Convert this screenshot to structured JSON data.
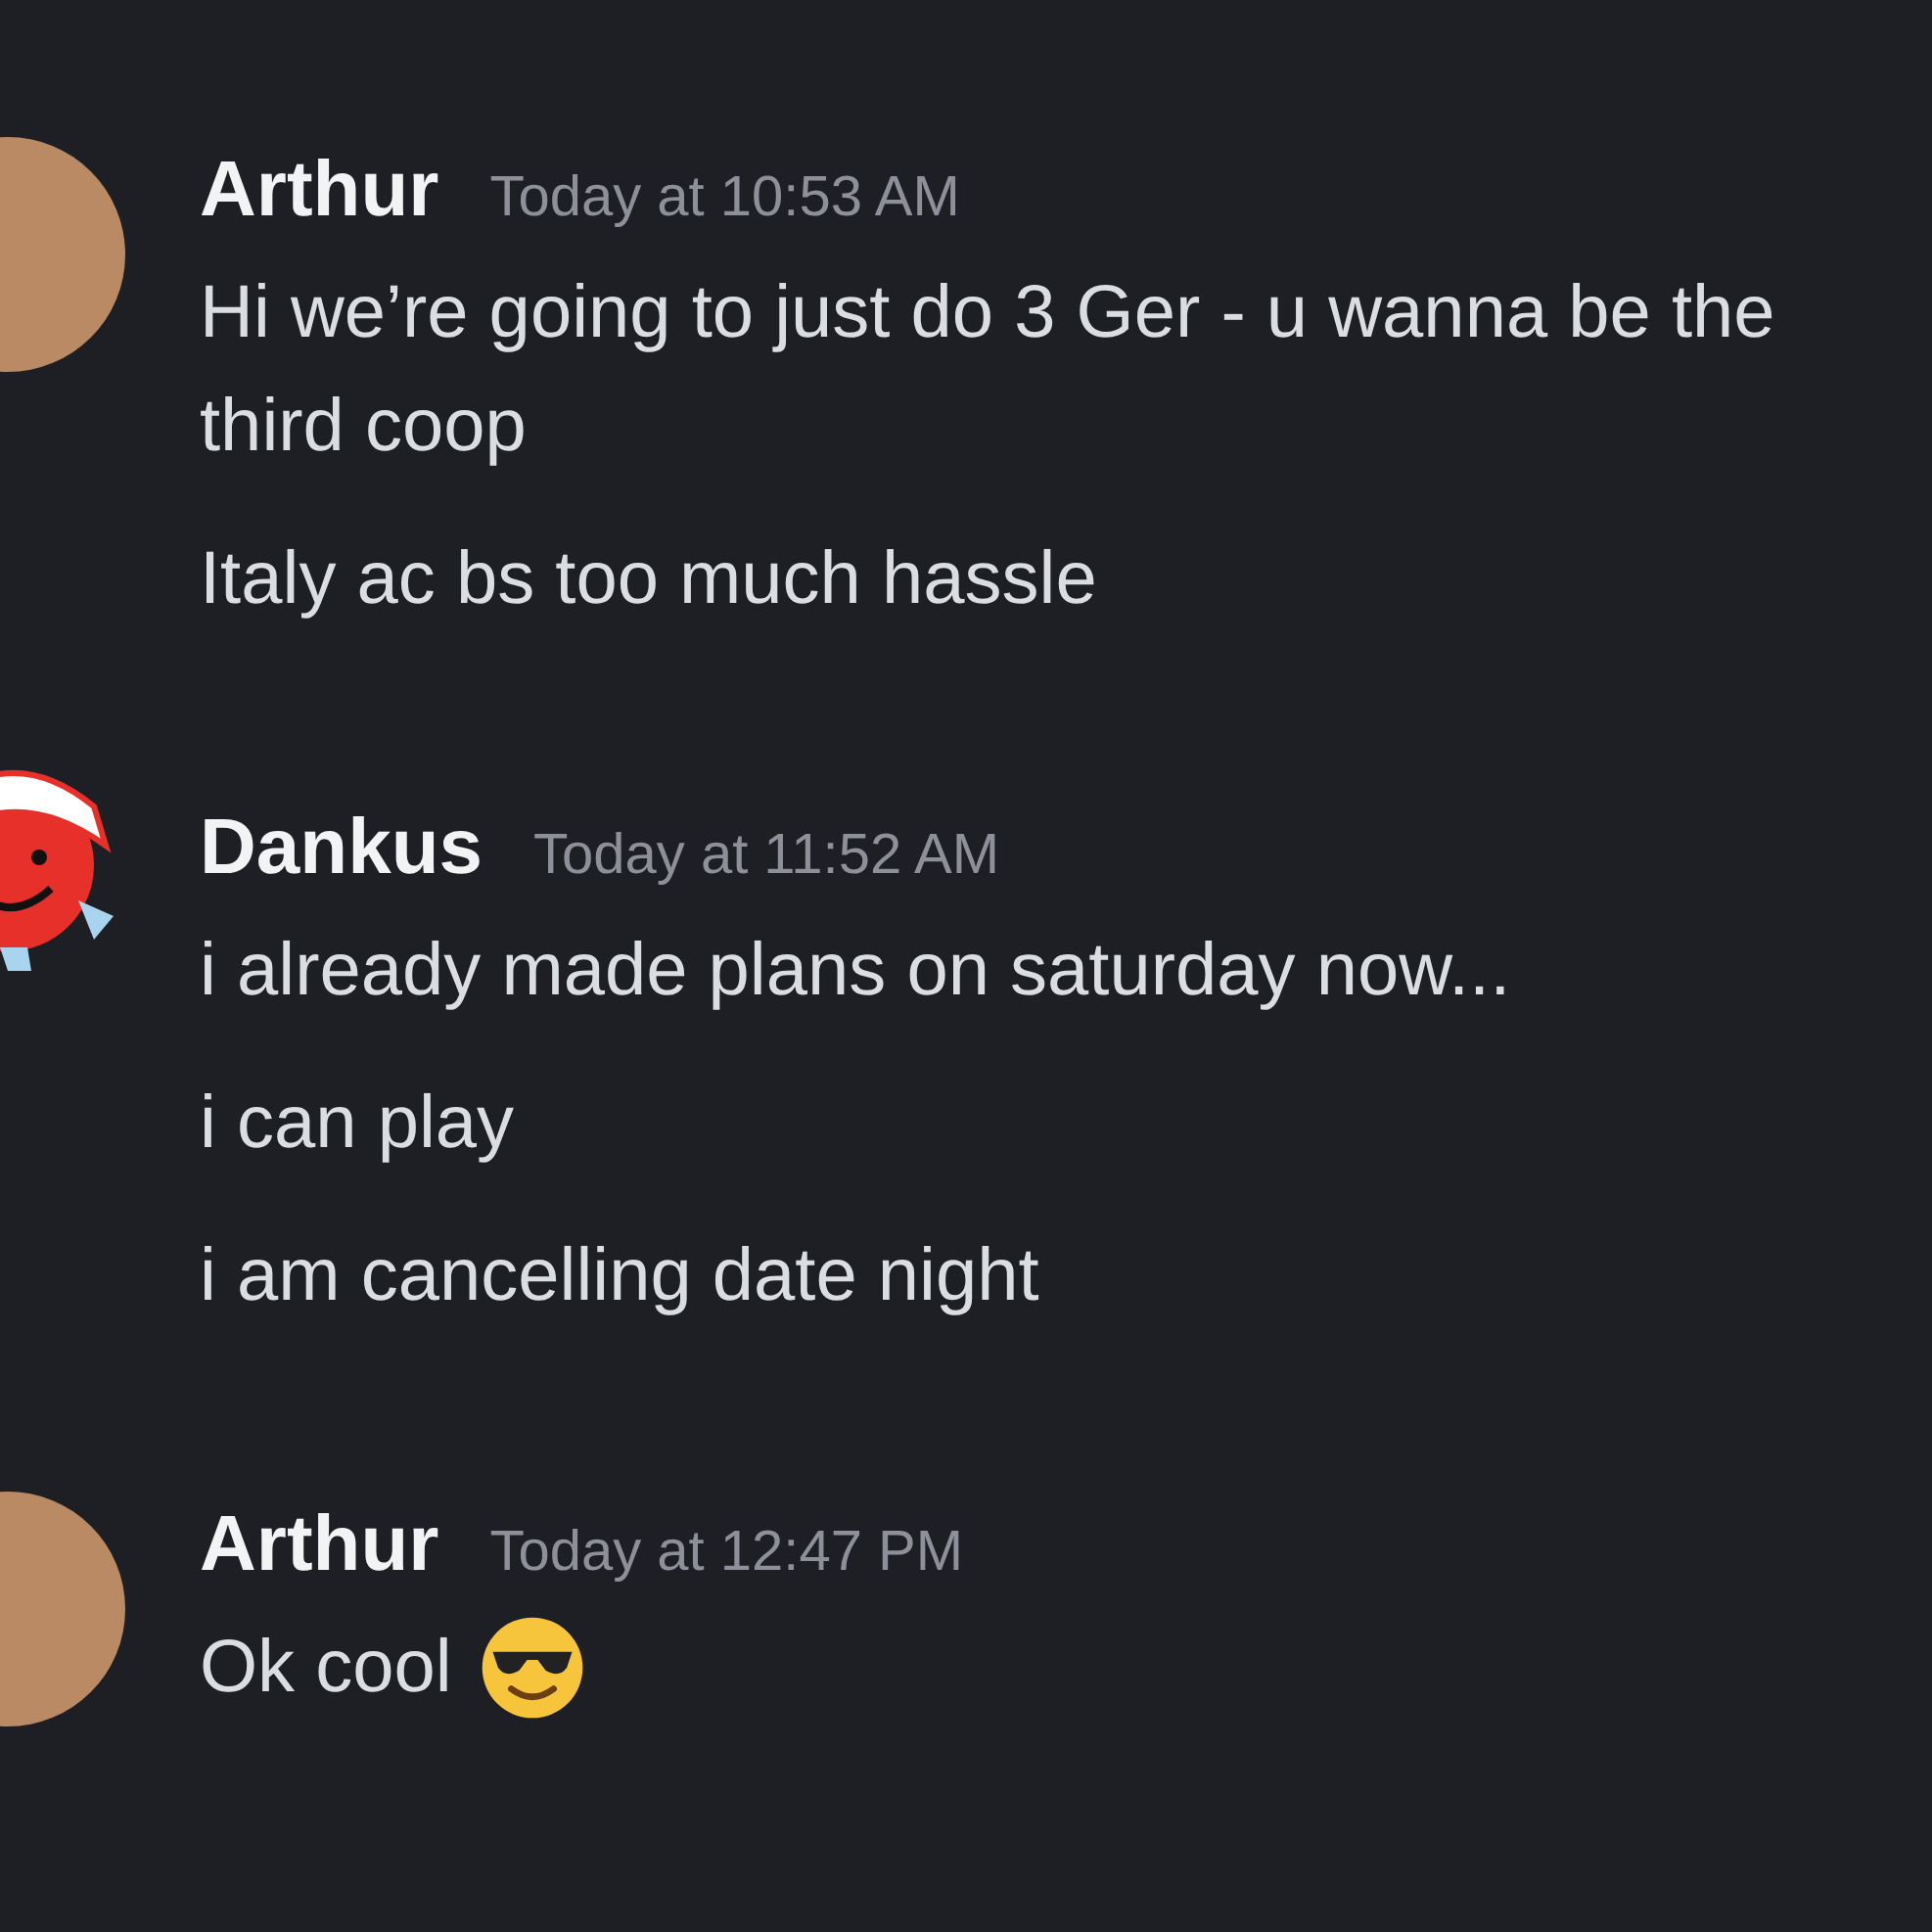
{
  "messages": [
    {
      "author": "Arthur",
      "avatar": {
        "kind": "photo"
      },
      "time": "Today at 10:53 AM",
      "lines": [
        {
          "text": "Hi we’re going to just do 3 Ger - u wanna be the third coop"
        },
        {
          "text": "Italy ac bs too much hassle"
        }
      ]
    },
    {
      "author": "Dankus",
      "avatar": {
        "kind": "cartoon"
      },
      "time": "Today at 11:52 AM",
      "lines": [
        {
          "text": "i already made plans on saturday now..."
        },
        {
          "text": "i can play"
        },
        {
          "text": "i am cancelling date night"
        }
      ]
    },
    {
      "author": "Arthur",
      "avatar": {
        "kind": "photo"
      },
      "time": "Today at 12:47 PM",
      "lines": [
        {
          "text": "Ok cool",
          "emoji": {
            "kind": "sunglasses"
          }
        }
      ]
    }
  ]
}
